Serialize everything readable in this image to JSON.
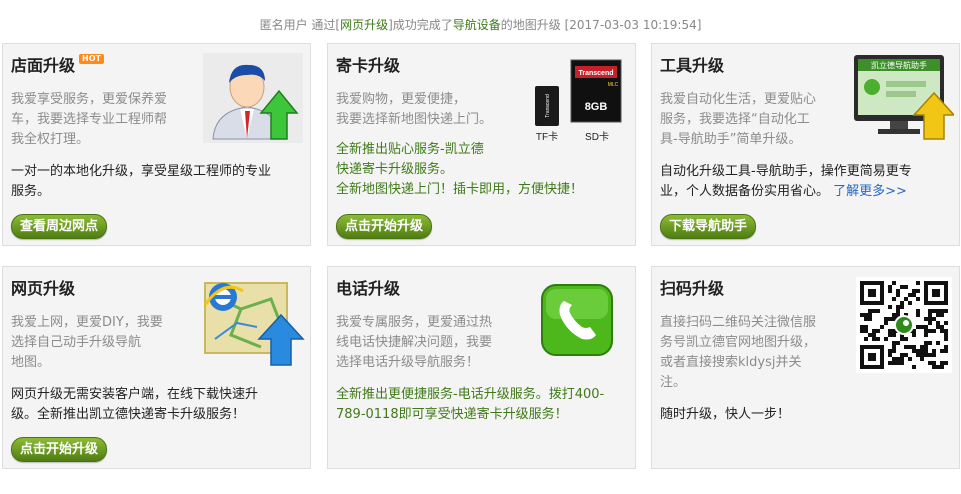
{
  "notice": {
    "prefix": "匿名用户 通过[",
    "link_method": "网页升级",
    "middle": "]成功完成了",
    "link_device": "导航设备",
    "suffix": "的地图升级 [2017-03-03 10:19:54]"
  },
  "cards": [
    {
      "title": "店面升级",
      "badge": "HOT",
      "desc": [
        "我爱享受服务，更爱保养爱",
        "车，我要选择专业工程师帮",
        "我全权打理。"
      ],
      "info": [
        "一对一的本地化升级，享受星级工程师的专业",
        "服务。"
      ],
      "button": "查看周边网点"
    },
    {
      "title": "寄卡升级",
      "desc": [
        "我爱购物，更爱便捷，",
        "我要选择新地图快递上门。"
      ],
      "info": [
        "全新推出贴心服务-凯立德",
        "快递寄卡升级服务。",
        "全新地图快递上门！插卡即用，方便快捷！"
      ],
      "button": "点击开始升级",
      "card_labels": {
        "tf_card": "TF卡",
        "sd_card": "SD卡",
        "sd_brand": "Transcend",
        "sd_capacity": "8GB",
        "sd_type": "MLC",
        "tf_brand": "Transcend",
        "tf_capacity": "8GB"
      }
    },
    {
      "title": "工具升级",
      "desc": [
        "我爱自动化生活，更爱贴心",
        "服务，我要选择“自动化工",
        "具-导航助手”简单升级。"
      ],
      "info": [
        "自动化升级工具-导航助手，操作更简易更专",
        "业，个人数据备份实用省心。"
      ],
      "more": "了解更多>>",
      "button": "下载导航助手",
      "screen_text": "凯立德导航助手"
    },
    {
      "title": "网页升级",
      "desc": [
        "我爱上网，更爱DIY，我要",
        "选择自己动手升级导航",
        "地图。"
      ],
      "info": [
        "网页升级无需安装客户端，在线下载快速升",
        "级。全新推出凯立德快递寄卡升级服务！"
      ],
      "button": "点击开始升级"
    },
    {
      "title": "电话升级",
      "desc": [
        "我爱专属服务，更爱通过热",
        "线电话快捷解决问题，我要",
        "选择电话升级导航服务！"
      ],
      "info": [
        "全新推出更便捷服务-电话升级服务。拨打400-",
        "789-0118即可享受快递寄卡升级服务！"
      ]
    },
    {
      "title": "扫码升级",
      "desc": [
        "直接扫码二维码关注微信服",
        "务号凯立德官网地图升级，",
        "或者直接搜索kldysj并关",
        "注。"
      ],
      "info": [
        "随时升级，快人一步！"
      ]
    }
  ],
  "colors": {
    "accent_green": "#3f7a18",
    "link_blue": "#2567c2",
    "button_top": "#8cbc35",
    "button_bottom": "#4f7d13",
    "hot_badge": "#ff8a1a"
  },
  "icons": [
    "user-upgrade-icon",
    "memory-cards-icon",
    "monitor-tool-icon",
    "web-map-icon",
    "phone-icon",
    "qr-code-icon"
  ]
}
